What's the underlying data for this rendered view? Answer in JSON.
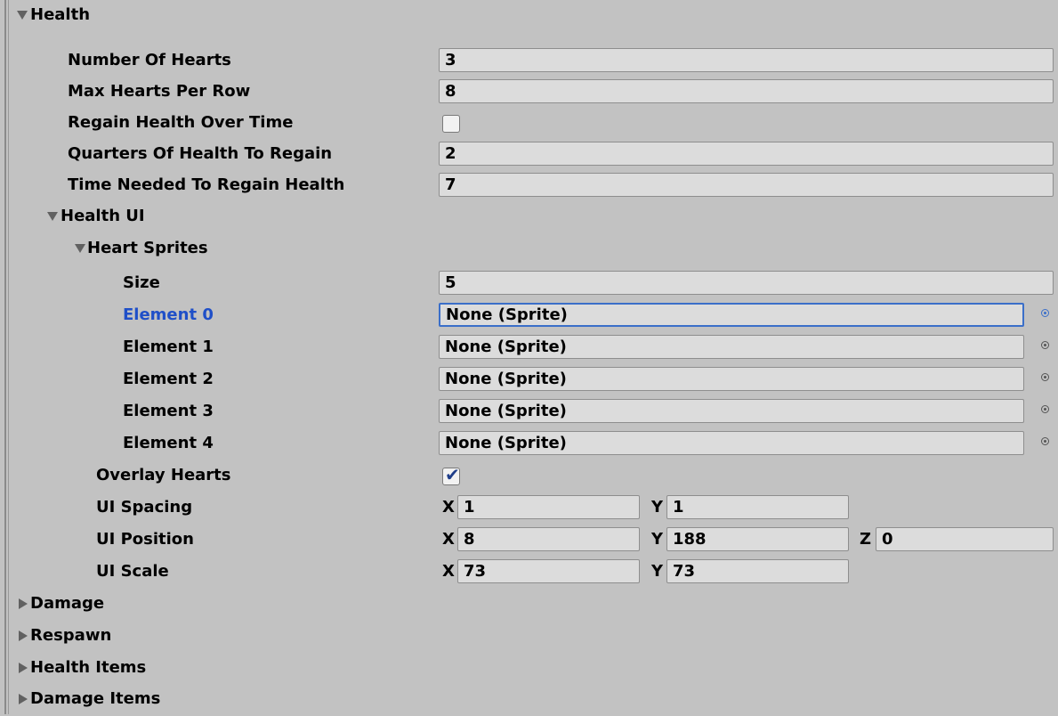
{
  "health": {
    "header": "Health",
    "number_of_hearts": {
      "label": "Number Of Hearts",
      "value": "3"
    },
    "max_hearts_per_row": {
      "label": "Max Hearts Per Row",
      "value": "8"
    },
    "regain_health_over_time": {
      "label": "Regain Health Over Time",
      "checked": false
    },
    "quarters_of_health_to_regain": {
      "label": "Quarters Of Health To Regain",
      "value": "2"
    },
    "time_needed_to_regain_health": {
      "label": "Time Needed To Regain Health",
      "value": "7"
    },
    "health_ui": {
      "header": "Health UI",
      "heart_sprites": {
        "header": "Heart Sprites",
        "size": {
          "label": "Size",
          "value": "5"
        },
        "elements": [
          {
            "label": "Element 0",
            "value": "None (Sprite)",
            "focused": true
          },
          {
            "label": "Element 1",
            "value": "None (Sprite)"
          },
          {
            "label": "Element 2",
            "value": "None (Sprite)"
          },
          {
            "label": "Element 3",
            "value": "None (Sprite)"
          },
          {
            "label": "Element 4",
            "value": "None (Sprite)"
          }
        ]
      },
      "overlay_hearts": {
        "label": "Overlay Hearts",
        "checked": true
      },
      "ui_spacing": {
        "label": "UI Spacing",
        "x": "1",
        "y": "1"
      },
      "ui_position": {
        "label": "UI Position",
        "x": "8",
        "y": "188",
        "z": "0"
      },
      "ui_scale": {
        "label": "UI Scale",
        "x": "73",
        "y": "73"
      }
    }
  },
  "axis_labels": {
    "x": "X",
    "y": "Y",
    "z": "Z"
  },
  "collapsed_sections": [
    {
      "label": "Damage"
    },
    {
      "label": "Respawn"
    },
    {
      "label": "Health Items"
    },
    {
      "label": "Damage Items"
    }
  ],
  "colors": {
    "background": "#c2c2c2",
    "field": "#dcdcdc",
    "focus_border": "#3b6fc9",
    "focus_label": "#1f4fc8"
  },
  "icons": {
    "fold_open": "triangle-down-icon",
    "fold_closed": "triangle-right-icon",
    "object_picker": "object-picker-icon",
    "check": "checkmark-icon"
  }
}
